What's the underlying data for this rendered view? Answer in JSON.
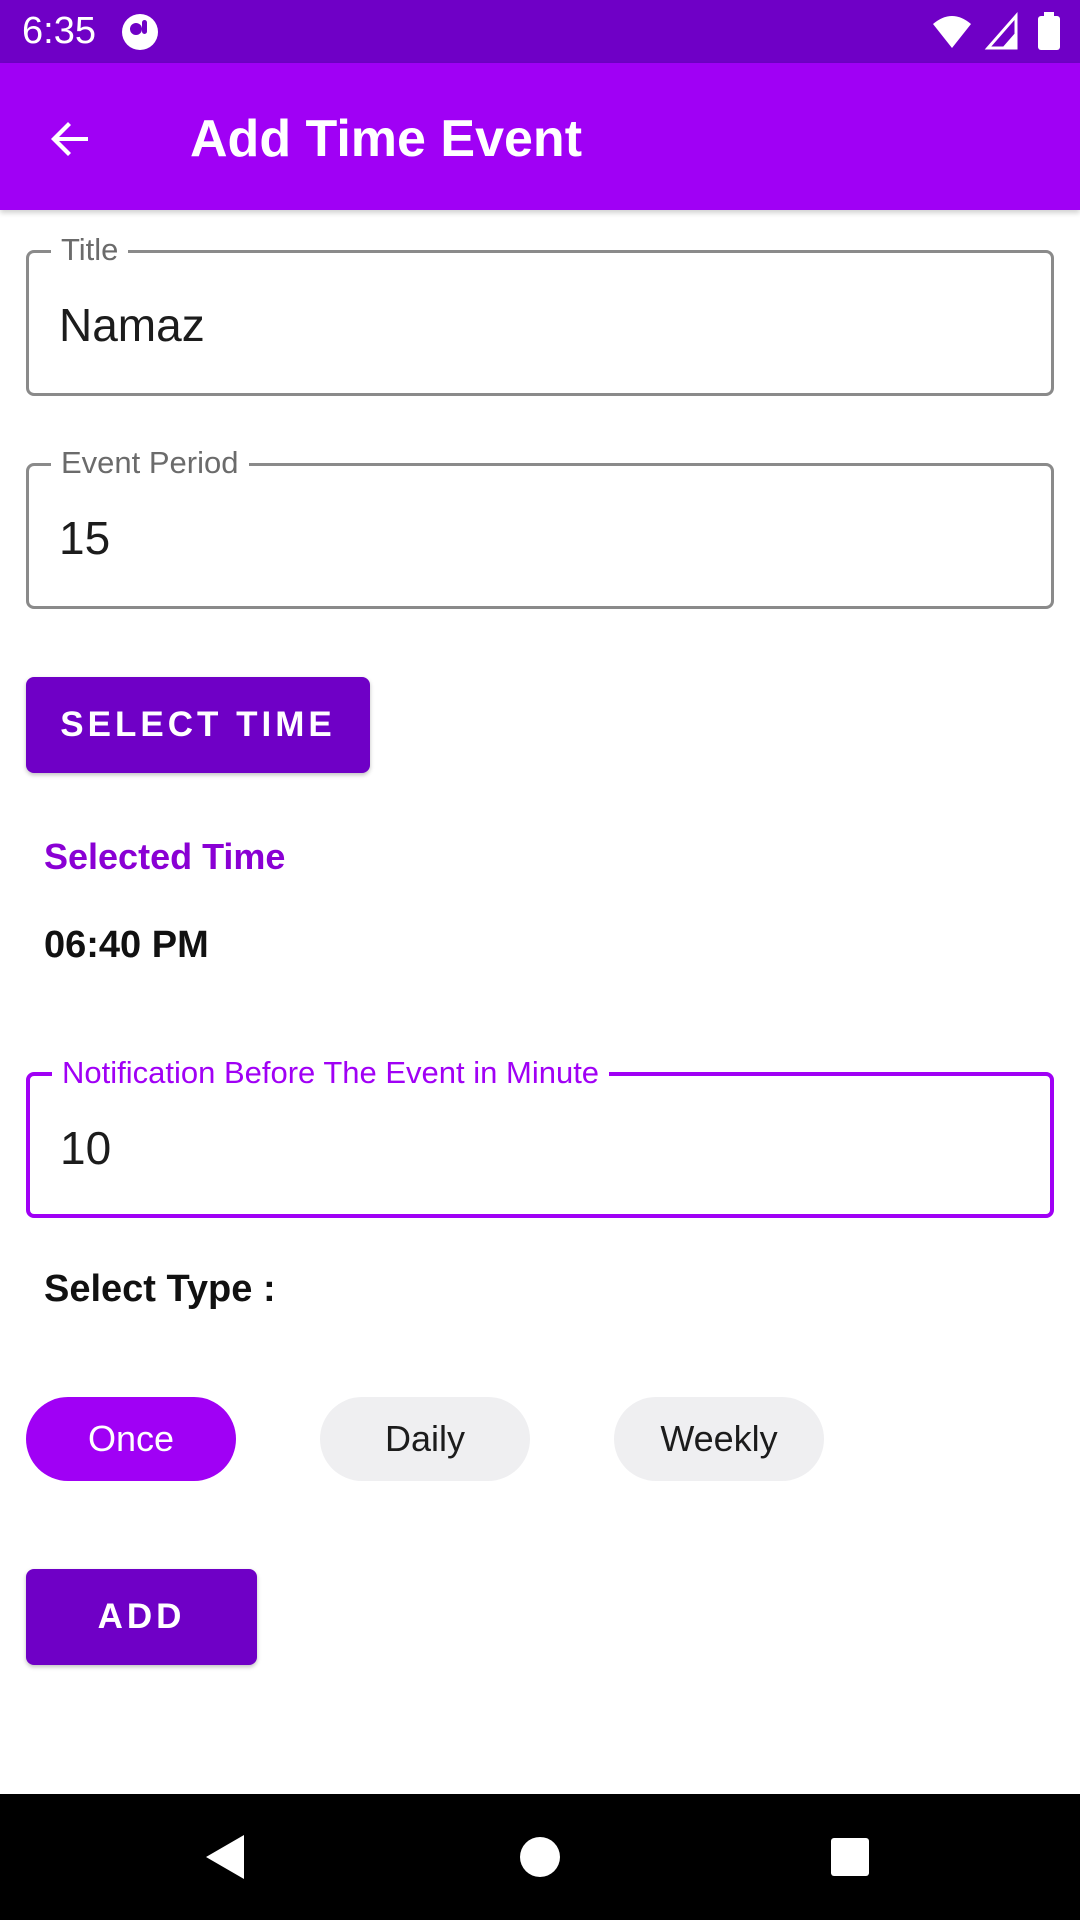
{
  "status_bar": {
    "time": "6:35",
    "icons": [
      "app-notification-icon",
      "wifi-icon",
      "cell-signal-icon",
      "battery-icon"
    ]
  },
  "app_bar": {
    "title": "Add Time Event",
    "back_icon": "arrow-back-icon"
  },
  "form": {
    "title_field": {
      "label": "Title",
      "value": "Namaz"
    },
    "period_field": {
      "label": "Event Period",
      "value": "15"
    },
    "select_time_button": "SELECT TIME",
    "selected_time_label": "Selected Time",
    "selected_time_value": "06:40 PM",
    "notification_field": {
      "label": "Notification Before The Event in Minute",
      "value": "10"
    },
    "select_type_label": "Select Type :",
    "type_chips": [
      {
        "label": "Once",
        "selected": true
      },
      {
        "label": "Daily",
        "selected": false
      },
      {
        "label": "Weekly",
        "selected": false
      }
    ],
    "add_button": "ADD"
  },
  "nav_bar": {
    "icons": [
      "nav-back-icon",
      "nav-home-icon",
      "nav-recents-icon"
    ]
  },
  "colors": {
    "status_bar": "#6f00c6",
    "app_bar": "#a000f5",
    "button": "#6f00c6",
    "accent": "#a000f5",
    "chip_unselected": "#efeff1"
  }
}
